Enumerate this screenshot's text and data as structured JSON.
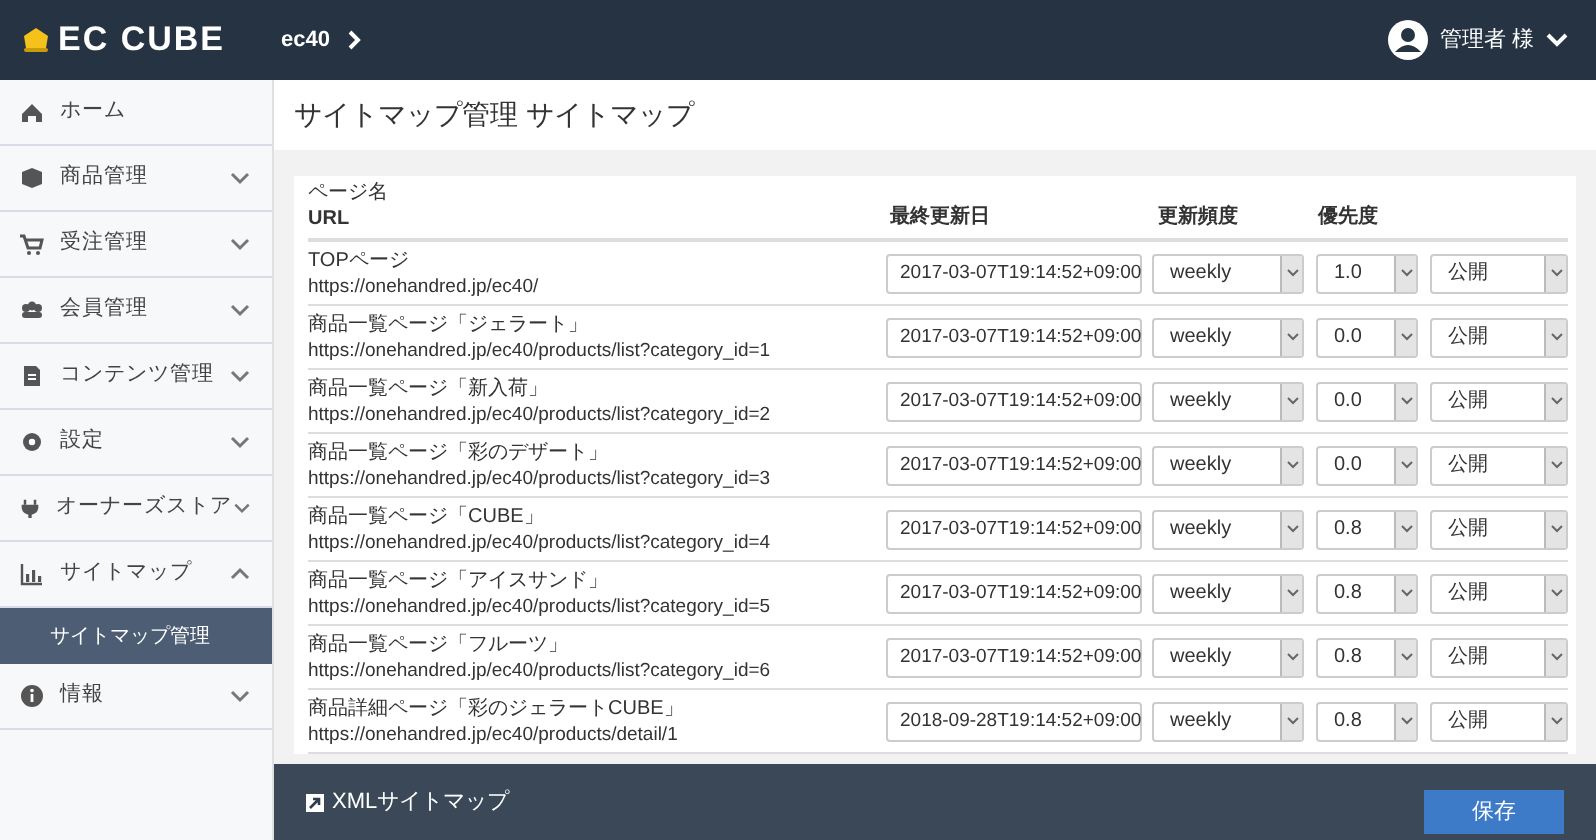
{
  "header": {
    "logo": "EC CUBE",
    "shop": "ec40",
    "user": "管理者 様"
  },
  "sidebar": {
    "items": [
      {
        "label": "ホーム"
      },
      {
        "label": "商品管理",
        "expanded": false
      },
      {
        "label": "受注管理",
        "expanded": false
      },
      {
        "label": "会員管理",
        "expanded": false
      },
      {
        "label": "コンテンツ管理",
        "expanded": false
      },
      {
        "label": "設定",
        "expanded": false
      },
      {
        "label": "オーナーズストア",
        "expanded": false
      },
      {
        "label": "サイトマップ",
        "expanded": true,
        "children": [
          {
            "label": "サイトマップ管理",
            "selected": true
          }
        ]
      },
      {
        "label": "情報",
        "expanded": false
      }
    ]
  },
  "page_title": "サイトマップ管理 サイトマップ",
  "table": {
    "columns": {
      "page_name": "ページ名",
      "url": "URL",
      "lastmod": "最終更新日",
      "changefreq": "更新頻度",
      "priority": "優先度"
    },
    "rows": [
      {
        "page_name": "TOPページ",
        "url": "https://onehandred.jp/ec40/",
        "lastmod": "2017-03-07T19:14:52+09:00",
        "changefreq": "weekly",
        "priority": "1.0",
        "status": "公開"
      },
      {
        "page_name": "商品一覧ページ「ジェラート」",
        "url": "https://onehandred.jp/ec40/products/list?category_id=1",
        "lastmod": "2017-03-07T19:14:52+09:00",
        "changefreq": "weekly",
        "priority": "0.0",
        "status": "公開"
      },
      {
        "page_name": "商品一覧ページ「新入荷」",
        "url": "https://onehandred.jp/ec40/products/list?category_id=2",
        "lastmod": "2017-03-07T19:14:52+09:00",
        "changefreq": "weekly",
        "priority": "0.0",
        "status": "公開"
      },
      {
        "page_name": "商品一覧ページ「彩のデザート」",
        "url": "https://onehandred.jp/ec40/products/list?category_id=3",
        "lastmod": "2017-03-07T19:14:52+09:00",
        "changefreq": "weekly",
        "priority": "0.0",
        "status": "公開"
      },
      {
        "page_name": "商品一覧ページ「CUBE」",
        "url": "https://onehandred.jp/ec40/products/list?category_id=4",
        "lastmod": "2017-03-07T19:14:52+09:00",
        "changefreq": "weekly",
        "priority": "0.8",
        "status": "公開"
      },
      {
        "page_name": "商品一覧ページ「アイスサンド」",
        "url": "https://onehandred.jp/ec40/products/list?category_id=5",
        "lastmod": "2017-03-07T19:14:52+09:00",
        "changefreq": "weekly",
        "priority": "0.8",
        "status": "公開"
      },
      {
        "page_name": "商品一覧ページ「フルーツ」",
        "url": "https://onehandred.jp/ec40/products/list?category_id=6",
        "lastmod": "2017-03-07T19:14:52+09:00",
        "changefreq": "weekly",
        "priority": "0.8",
        "status": "公開"
      },
      {
        "page_name": "商品詳細ページ「彩のジェラートCUBE」",
        "url": "https://onehandred.jp/ec40/products/detail/1",
        "lastmod": "2018-09-28T19:14:52+09:00",
        "changefreq": "weekly",
        "priority": "0.8",
        "status": "公開"
      }
    ]
  },
  "footer": {
    "link": "XMLサイトマップ",
    "save_button": "保存"
  }
}
